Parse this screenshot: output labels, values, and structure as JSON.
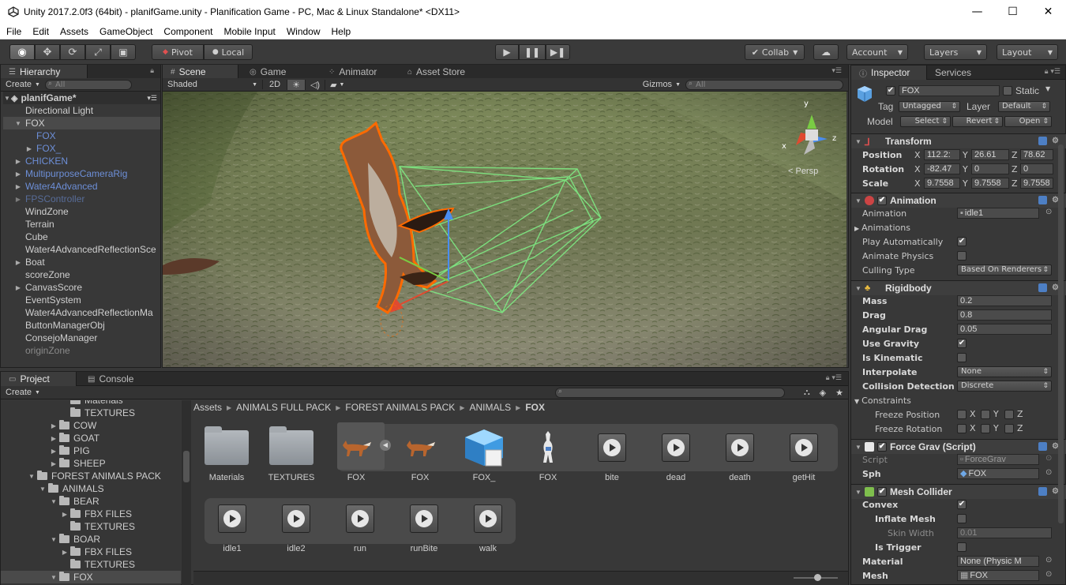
{
  "window": {
    "title": "Unity 2017.2.0f3 (64bit) - planifGame.unity - Planification Game - PC, Mac & Linux Standalone* <DX11>",
    "minimize": "—",
    "maximize": "☐",
    "close": "✕"
  },
  "menu": [
    "File",
    "Edit",
    "Assets",
    "GameObject",
    "Component",
    "Mobile Input",
    "Window",
    "Help"
  ],
  "toolbar": {
    "pivot": "Pivot",
    "local": "Local",
    "collab": "Collab",
    "account": "Account",
    "layers": "Layers",
    "layout": "Layout"
  },
  "hierarchy": {
    "tab": "Hierarchy",
    "create": "Create",
    "search_placeholder": "All",
    "items": [
      {
        "label": "planifGame*",
        "indent": 0
      },
      {
        "label": "Directional Light",
        "indent": 1
      },
      {
        "label": "FOX",
        "indent": 1
      },
      {
        "label": "FOX",
        "indent": 2
      },
      {
        "label": "FOX_",
        "indent": 2
      },
      {
        "label": "CHICKEN",
        "indent": 1
      },
      {
        "label": "MultipurposeCameraRig",
        "indent": 1
      },
      {
        "label": "Water4Advanced",
        "indent": 1
      },
      {
        "label": "FPSController",
        "indent": 1
      },
      {
        "label": "WindZone",
        "indent": 1
      },
      {
        "label": "Terrain",
        "indent": 1
      },
      {
        "label": "Cube",
        "indent": 1
      },
      {
        "label": "Water4AdvancedReflectionSce",
        "indent": 1
      },
      {
        "label": "Boat",
        "indent": 1
      },
      {
        "label": "scoreZone",
        "indent": 1
      },
      {
        "label": "CanvasScore",
        "indent": 1
      },
      {
        "label": "EventSystem",
        "indent": 1
      },
      {
        "label": "Water4AdvancedReflectionMa",
        "indent": 1
      },
      {
        "label": "ButtonManagerObj",
        "indent": 1
      },
      {
        "label": "ConsejoManager",
        "indent": 1
      },
      {
        "label": "originZone",
        "indent": 1
      }
    ]
  },
  "scene": {
    "tabs": [
      "Scene",
      "Game",
      "Animator",
      "Asset Store"
    ],
    "shading": "Shaded",
    "mode2d": "2D",
    "gizmos": "Gizmos",
    "search_placeholder": "All",
    "persp": "< Persp",
    "axes": {
      "x": "x",
      "y": "y",
      "z": "z"
    }
  },
  "inspector": {
    "tabs": [
      "Inspector",
      "Services"
    ],
    "object_name": "FOX",
    "static_label": "Static",
    "tag_label": "Tag",
    "tag_value": "Untagged",
    "layer_label": "Layer",
    "layer_value": "Default",
    "model_label": "Model",
    "model_select": "Select",
    "model_revert": "Revert",
    "model_open": "Open",
    "transform": {
      "title": "Transform",
      "position_label": "Position",
      "position": {
        "x": "112.2:",
        "y": "26.61",
        "z": "78.62"
      },
      "rotation_label": "Rotation",
      "rotation": {
        "x": "-82.47",
        "y": "0",
        "z": "0"
      },
      "scale_label": "Scale",
      "scale": {
        "x": "9.7558",
        "y": "9.7558",
        "z": "9.7558"
      }
    },
    "animation": {
      "title": "Animation",
      "animation_label": "Animation",
      "animation_value": "idle1",
      "animations_label": "Animations",
      "play_auto_label": "Play Automatically",
      "animate_physics_label": "Animate Physics",
      "culling_label": "Culling Type",
      "culling_value": "Based On Renderers"
    },
    "rigidbody": {
      "title": "Rigidbody",
      "mass_label": "Mass",
      "mass": "0.2",
      "drag_label": "Drag",
      "drag": "0.8",
      "angular_label": "Angular Drag",
      "angular": "0.05",
      "gravity_label": "Use Gravity",
      "kinematic_label": "Is Kinematic",
      "interpolate_label": "Interpolate",
      "interpolate": "None",
      "collision_label": "Collision Detection",
      "collision": "Discrete",
      "constraints_label": "Constraints",
      "freeze_pos_label": "Freeze Position",
      "freeze_rot_label": "Freeze Rotation"
    },
    "forcegrav": {
      "title": "Force Grav (Script)",
      "script_label": "Script",
      "script": "ForceGrav",
      "sph_label": "Sph",
      "sph": "FOX"
    },
    "meshcollider": {
      "title": "Mesh Collider",
      "convex_label": "Convex",
      "inflate_label": "Inflate Mesh",
      "skin_label": "Skin Width",
      "skin": "0.01",
      "trigger_label": "Is Trigger",
      "material_label": "Material",
      "material": "None (Physic M",
      "mesh_label": "Mesh",
      "mesh": "FOX"
    }
  },
  "project": {
    "tabs": [
      "Project",
      "Console"
    ],
    "create": "Create",
    "tree": [
      {
        "label": "Materials",
        "indent": 5,
        "arrow": false
      },
      {
        "label": "TEXTURES",
        "indent": 5,
        "arrow": false
      },
      {
        "label": "COW",
        "indent": 4,
        "arrow": true
      },
      {
        "label": "GOAT",
        "indent": 4,
        "arrow": true
      },
      {
        "label": "PIG",
        "indent": 4,
        "arrow": true
      },
      {
        "label": "SHEEP",
        "indent": 4,
        "arrow": true
      },
      {
        "label": "FOREST ANIMALS PACK",
        "indent": 2,
        "arrow": true
      },
      {
        "label": "ANIMALS",
        "indent": 3,
        "arrow": true
      },
      {
        "label": "BEAR",
        "indent": 4,
        "arrow": true
      },
      {
        "label": "FBX FILES",
        "indent": 5,
        "arrow": true
      },
      {
        "label": "TEXTURES",
        "indent": 5,
        "arrow": false
      },
      {
        "label": "BOAR",
        "indent": 4,
        "arrow": true
      },
      {
        "label": "FBX FILES",
        "indent": 5,
        "arrow": true
      },
      {
        "label": "TEXTURES",
        "indent": 5,
        "arrow": false
      },
      {
        "label": "FOX",
        "indent": 4,
        "arrow": true
      }
    ],
    "breadcrumb": [
      "Assets",
      "ANIMALS FULL PACK",
      "FOREST ANIMALS PACK",
      "ANIMALS",
      "FOX"
    ],
    "assets_row1": [
      {
        "label": "Materials",
        "kind": "folder"
      },
      {
        "label": "TEXTURES",
        "kind": "folder"
      },
      {
        "label": "FOX",
        "kind": "model"
      },
      {
        "label": "FOX",
        "kind": "model"
      },
      {
        "label": "FOX_",
        "kind": "prefab"
      },
      {
        "label": "FOX",
        "kind": "avatar"
      },
      {
        "label": "bite",
        "kind": "anim"
      },
      {
        "label": "dead",
        "kind": "anim"
      },
      {
        "label": "death",
        "kind": "anim"
      },
      {
        "label": "getHit",
        "kind": "anim"
      }
    ],
    "assets_row2": [
      {
        "label": "idle1",
        "kind": "anim"
      },
      {
        "label": "idle2",
        "kind": "anim"
      },
      {
        "label": "run",
        "kind": "anim"
      },
      {
        "label": "runBite",
        "kind": "anim"
      },
      {
        "label": "walk",
        "kind": "anim"
      }
    ]
  },
  "colors": {
    "accent_blue": "#4d7fc4",
    "collider_green": "#6ee07a",
    "selection_orange": "#ff6a00"
  }
}
